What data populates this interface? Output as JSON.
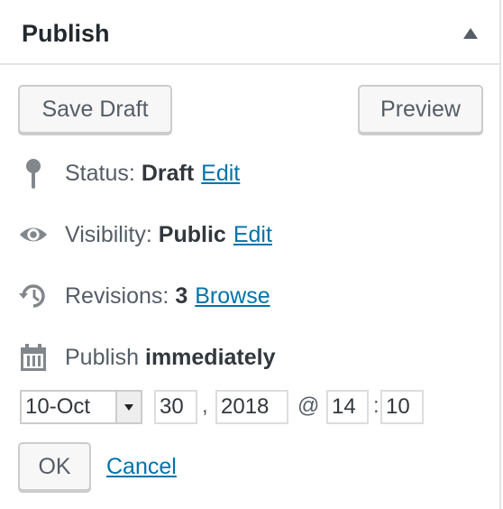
{
  "header": {
    "title": "Publish",
    "toggle_icon": "triangle-up-icon"
  },
  "actions": {
    "save_draft": "Save Draft",
    "preview": "Preview"
  },
  "status": {
    "label": "Status:",
    "value": "Draft",
    "edit": "Edit",
    "icon": "pin-icon"
  },
  "visibility": {
    "label": "Visibility:",
    "value": "Public",
    "edit": "Edit",
    "icon": "eye-icon"
  },
  "revisions": {
    "label": "Revisions:",
    "value": "3",
    "browse": "Browse",
    "icon": "history-icon"
  },
  "schedule": {
    "label": "Publish",
    "value": "immediately",
    "icon": "calendar-icon",
    "month": "10-Oct",
    "day": "30",
    "comma": ",",
    "year": "2018",
    "at": "@",
    "hour": "14",
    "colon": ":",
    "minute": "10",
    "ok": "OK",
    "cancel": "Cancel"
  },
  "colors": {
    "link": "#0073aa",
    "border": "#e2e4e7",
    "text": "#555d66"
  }
}
